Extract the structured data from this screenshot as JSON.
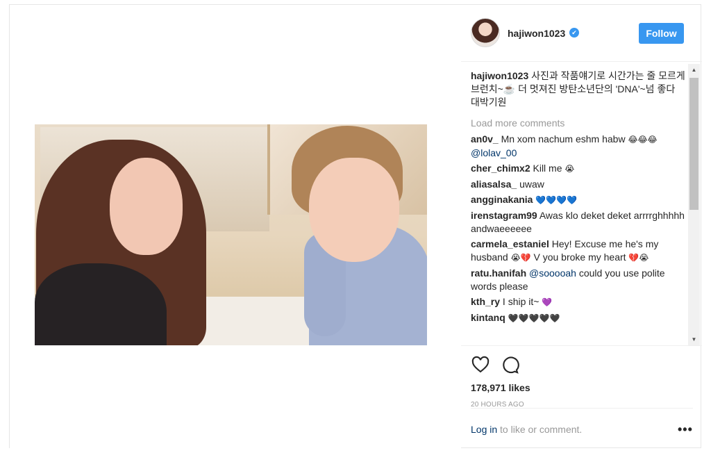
{
  "header": {
    "username": "hajiwon1023",
    "follow_label": "Follow"
  },
  "caption": {
    "username": "hajiwon1023",
    "text": "사진과 작품얘기로 시간가는 줄 모르게 브런치~☕ 더 멋져진 방탄소년단의 'DNA'~넘 좋다 대박기원"
  },
  "load_more": "Load more comments",
  "comments": [
    {
      "user": "an0v_",
      "text": "Mn xom nachum eshm habw",
      "emoji": "😂😂😂",
      "mention": "@lolav_00"
    },
    {
      "user": "cher_chimx2",
      "text": "Kill me",
      "emoji": "😭"
    },
    {
      "user": "aliasalsa_",
      "text": "uwaw"
    },
    {
      "user": "angginakania",
      "text": "",
      "emoji": "💙💙💙💙"
    },
    {
      "user": "irenstagram99",
      "text": "Awas klo deket deket arrrrghhhhh andwaeeeeee"
    },
    {
      "user": "carmela_estaniel",
      "text": "Hey! Excuse me he's my husband",
      "emoji": "😭💔",
      "text2": "V you broke my heart",
      "emoji2": "💔😭"
    },
    {
      "user": "ratu.hanifah",
      "mention": "@sooooah",
      "text": "could you use polite words please"
    },
    {
      "user": "kth_ry",
      "text": "I ship it~",
      "emoji": "💜"
    },
    {
      "user": "kintanq",
      "text": "",
      "emoji": "🖤🖤🖤🖤🖤"
    }
  ],
  "actions": {
    "likes": "178,971 likes",
    "time": "20 HOURS AGO"
  },
  "footer": {
    "login_link": "Log in",
    "login_rest": " to like or comment.",
    "more": "•••"
  }
}
